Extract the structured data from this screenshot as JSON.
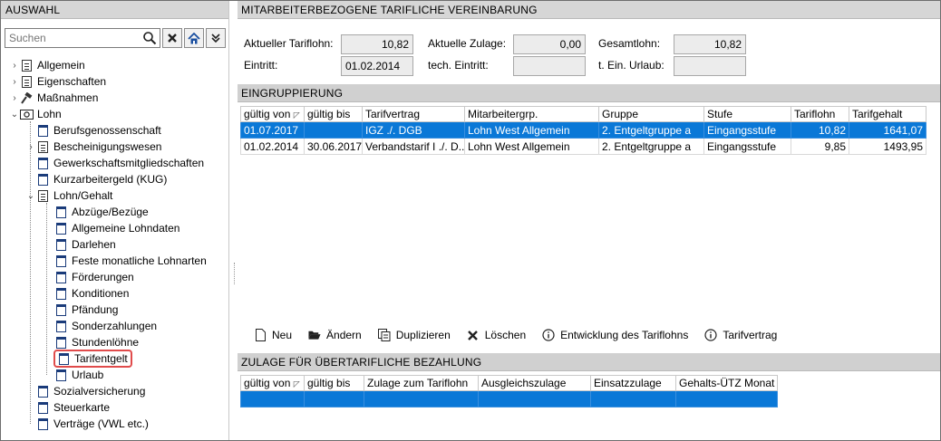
{
  "left": {
    "header": "AUSWAHL",
    "search_placeholder": "Suchen",
    "tree": [
      {
        "label": "Allgemein",
        "icon": "list-icon"
      },
      {
        "label": "Eigenschaften",
        "icon": "list-icon"
      },
      {
        "label": "Maßnahmen",
        "icon": "hammer-icon"
      },
      {
        "label": "Lohn",
        "icon": "money-icon"
      },
      {
        "label": "Berufsgenossenschaft",
        "icon": "doc-icon"
      },
      {
        "label": "Bescheinigungswesen",
        "icon": "docs-icon"
      },
      {
        "label": "Gewerkschaftsmitgliedschaften",
        "icon": "doc-icon"
      },
      {
        "label": "Kurzarbeitergeld (KUG)",
        "icon": "doc-icon"
      },
      {
        "label": "Lohn/Gehalt",
        "icon": "docs-icon"
      },
      {
        "label": "Abzüge/Bezüge",
        "icon": "doc-icon"
      },
      {
        "label": "Allgemeine Lohndaten",
        "icon": "doc-icon"
      },
      {
        "label": "Darlehen",
        "icon": "doc-icon"
      },
      {
        "label": "Feste monatliche Lohnarten",
        "icon": "doc-icon"
      },
      {
        "label": "Förderungen",
        "icon": "doc-icon"
      },
      {
        "label": "Konditionen",
        "icon": "doc-icon"
      },
      {
        "label": "Pfändung",
        "icon": "doc-icon"
      },
      {
        "label": "Sonderzahlungen",
        "icon": "doc-icon"
      },
      {
        "label": "Stundenlöhne",
        "icon": "doc-icon"
      },
      {
        "label": "Tarifentgelt",
        "icon": "doc-icon"
      },
      {
        "label": "Urlaub",
        "icon": "doc-icon"
      },
      {
        "label": "Sozialversicherung",
        "icon": "doc-icon"
      },
      {
        "label": "Steuerkarte",
        "icon": "doc-icon"
      },
      {
        "label": "Verträge (VWL etc.)",
        "icon": "doc-icon"
      }
    ]
  },
  "main": {
    "header": "MITARBEITERBEZOGENE TARIFLICHE VEREINBARUNG",
    "fields": {
      "aktueller_tariflohn_label": "Aktueller Tariflohn:",
      "aktueller_tariflohn": "10,82",
      "aktuelle_zulage_label": "Aktuelle Zulage:",
      "aktuelle_zulage": "0,00",
      "gesamtlohn_label": "Gesamtlohn:",
      "gesamtlohn": "10,82",
      "eintritt_label": "Eintritt:",
      "eintritt": "01.02.2014",
      "tech_eintritt_label": "tech. Eintritt:",
      "tech_eintritt": "",
      "urlaub_label": "t. Ein. Urlaub:",
      "urlaub": ""
    },
    "eingruppierung": {
      "header": "EINGRUPPIERUNG",
      "columns": [
        "gültig von",
        "gültig bis",
        "Tarifvertrag",
        "Mitarbeitergrp.",
        "Gruppe",
        "Stufe",
        "Tariflohn",
        "Tarifgehalt"
      ],
      "rows": [
        [
          "01.07.2017",
          "",
          "IGZ ./. DGB",
          "Lohn West Allgemein",
          "2. Entgeltgruppe a",
          "Eingangsstufe",
          "10,82",
          "1641,07"
        ],
        [
          "01.02.2014",
          "30.06.2017",
          "Verbandstarif I ./. D...",
          "Lohn West Allgemein",
          "2. Entgeltgruppe a",
          "Eingangsstufe",
          "9,85",
          "1493,95"
        ]
      ]
    },
    "actions": [
      {
        "label": "Neu",
        "icon": "new-doc-icon"
      },
      {
        "label": "Ändern",
        "icon": "folder-open-icon"
      },
      {
        "label": "Duplizieren",
        "icon": "duplicate-icon"
      },
      {
        "label": "Löschen",
        "icon": "delete-x-icon"
      },
      {
        "label": "Entwicklung des Tariflohns",
        "icon": "info-icon"
      },
      {
        "label": "Tarifvertrag",
        "icon": "info-icon"
      }
    ],
    "zulage": {
      "header": "ZULAGE FÜR ÜBERTARIFLICHE BEZAHLUNG",
      "columns": [
        "gültig von",
        "gültig bis",
        "Zulage zum Tariflohn",
        "Ausgleichszulage",
        "Einsatzzulage",
        "Gehalts-ÜTZ Monat"
      ]
    }
  },
  "colors": {
    "selection": "#0a78d7",
    "header_bg": "#d6d6d6",
    "highlight": "#e04b4b"
  }
}
